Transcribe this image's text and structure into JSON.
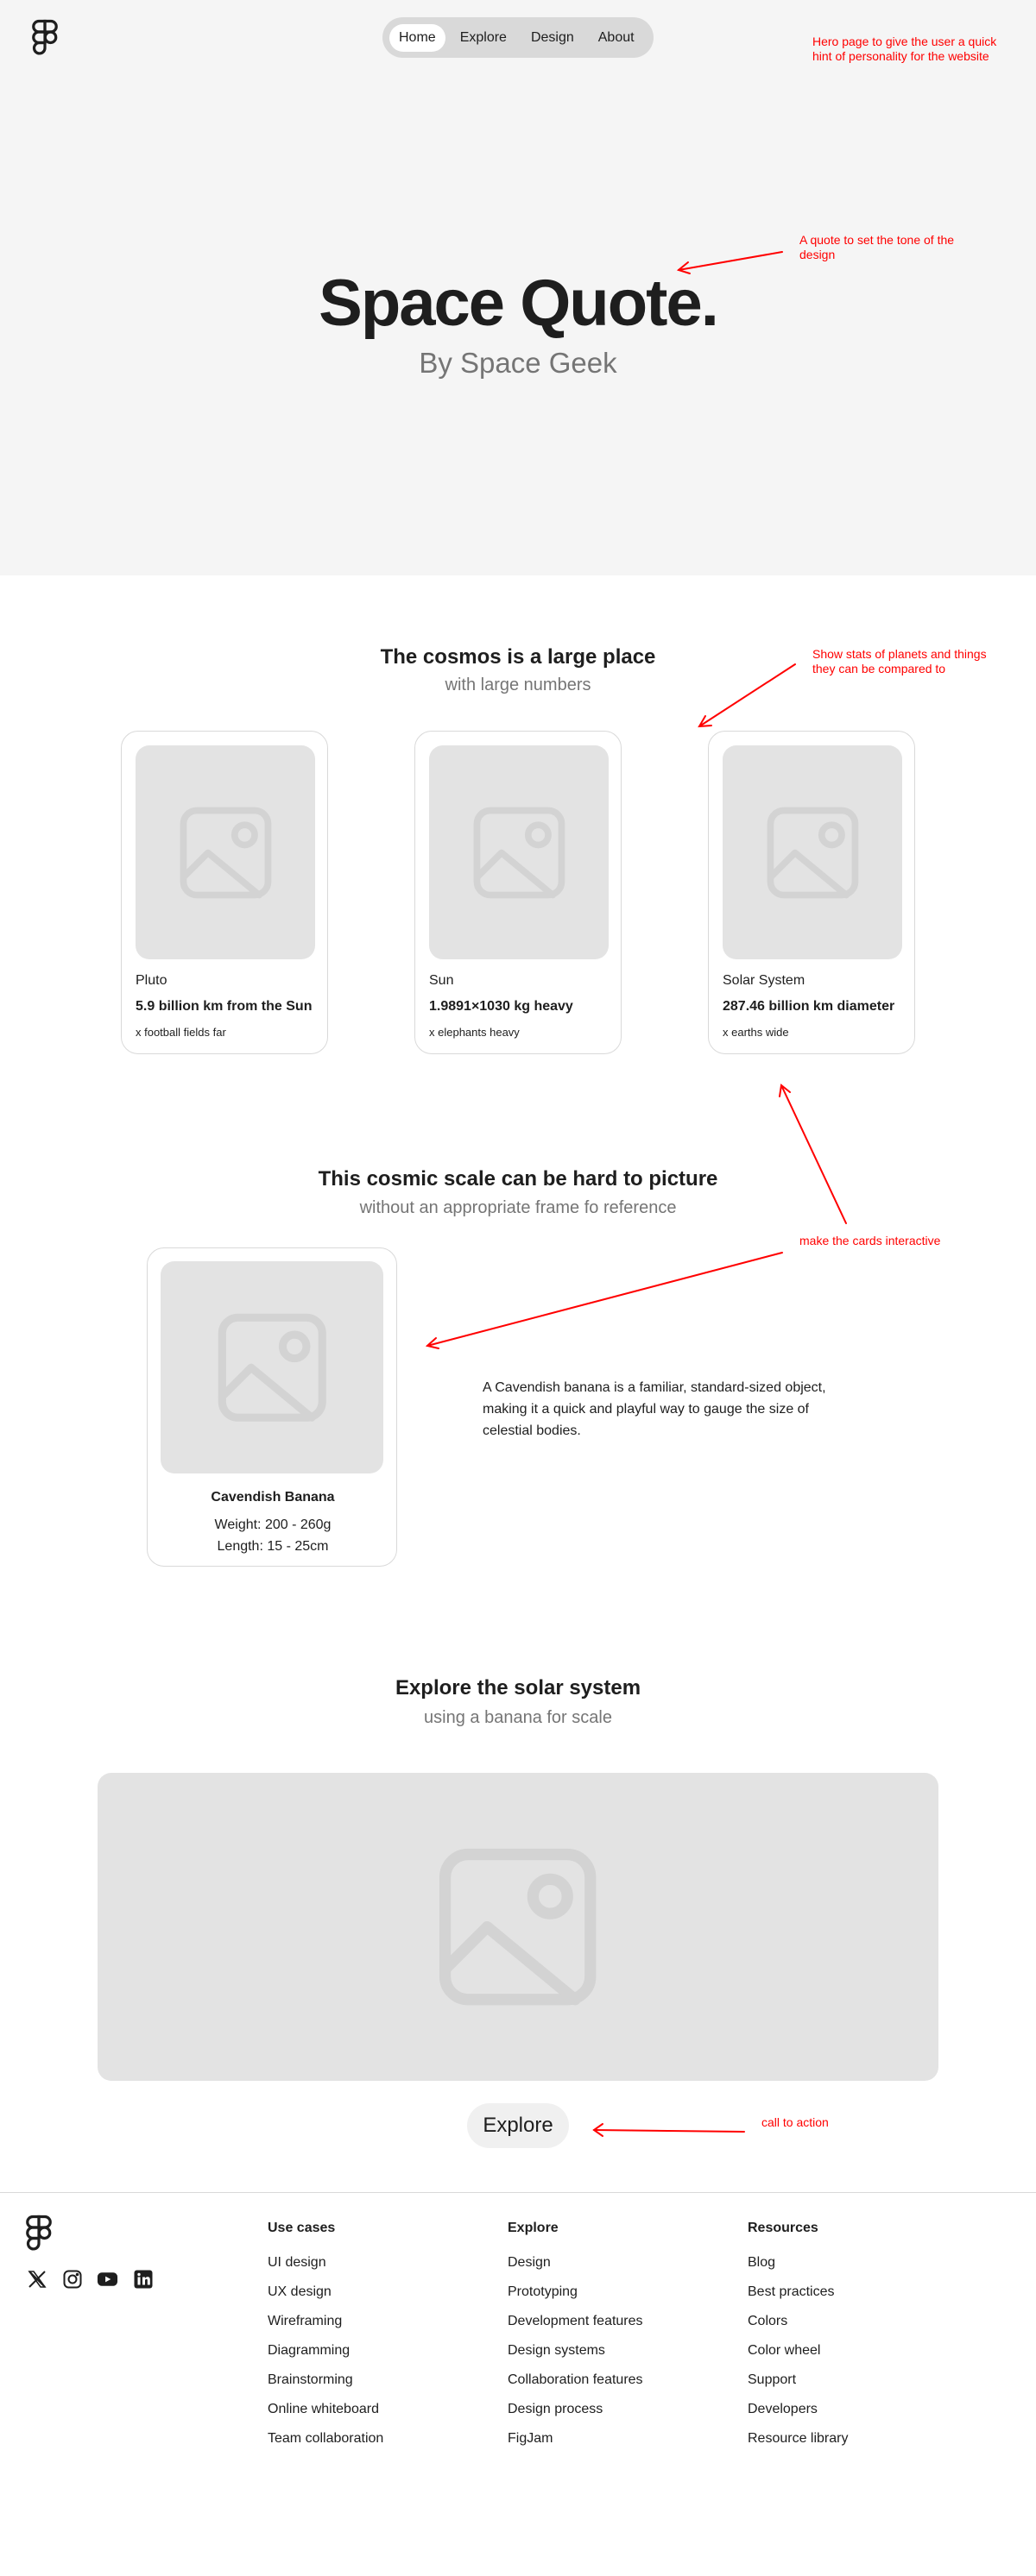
{
  "nav": {
    "items": [
      "Home",
      "Explore",
      "Design",
      "About"
    ],
    "active": "Home"
  },
  "hero": {
    "title": "Space Quote.",
    "subtitle": "By Space Geek"
  },
  "stats_section": {
    "title": "The cosmos is a large place",
    "subtitle": "with large numbers",
    "cards": [
      {
        "name": "Pluto",
        "stat": "5.9 billion km from the Sun",
        "compare": "x football fields far"
      },
      {
        "name": "Sun",
        "stat": "1.9891×1030 kg heavy",
        "compare": "x elephants heavy"
      },
      {
        "name": "Solar System",
        "stat": "287.46 billion km diameter",
        "compare": "x earths wide"
      }
    ]
  },
  "scale_section": {
    "title": "This cosmic scale can be hard to picture",
    "subtitle": "without an appropriate frame fo reference",
    "banana": {
      "name": "Cavendish Banana",
      "weight": "Weight: 200 - 260g",
      "length": "Length: 15 - 25cm"
    },
    "description": "A Cavendish banana is a familiar, standard-sized object, making it a quick and playful way to gauge the size of celestial bodies."
  },
  "explore_section": {
    "title": "Explore the solar system",
    "subtitle": "using a banana for scale",
    "button": "Explore"
  },
  "annotations": {
    "hero": "Hero page to give the user a quick hint of personality for the website",
    "quote": "A quote to set the tone of the design",
    "stats": "Show stats of planets and things they can be compared to",
    "interactive": "make the cards interactive",
    "cta": "call to action"
  },
  "footer": {
    "columns": [
      {
        "heading": "Use cases",
        "links": [
          "UI design",
          "UX design",
          "Wireframing",
          "Diagramming",
          "Brainstorming",
          "Online whiteboard",
          "Team collaboration"
        ]
      },
      {
        "heading": "Explore",
        "links": [
          "Design",
          "Prototyping",
          "Development features",
          "Design systems",
          "Collaboration features",
          "Design process",
          "FigJam"
        ]
      },
      {
        "heading": "Resources",
        "links": [
          "Blog",
          "Best practices",
          "Colors",
          "Color wheel",
          "Support",
          "Developers",
          "Resource library"
        ]
      }
    ],
    "socials": [
      "x-icon",
      "instagram-icon",
      "youtube-icon",
      "linkedin-icon"
    ]
  },
  "colors": {
    "annotation": "#ff0000",
    "hero_bg": "#f5f5f5",
    "placeholder": "#e3e3e3",
    "muted_text": "#757575"
  }
}
